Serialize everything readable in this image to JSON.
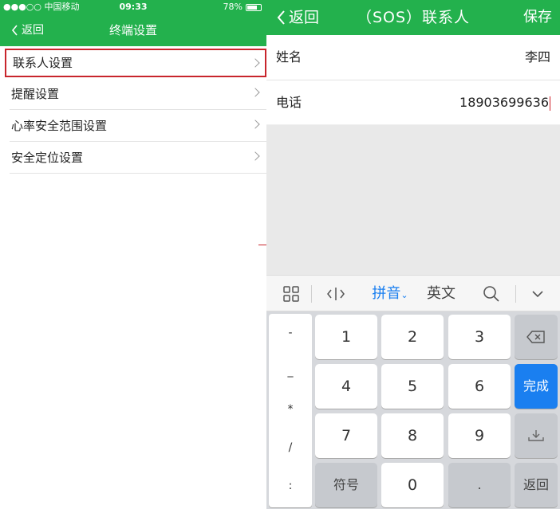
{
  "left": {
    "status": {
      "carrier": "●●●○○ 中国移动",
      "time": "09:33",
      "battery": "78%",
      "battery_level": 0.78
    },
    "nav": {
      "back": "返回",
      "title": "终端设置"
    },
    "menu": [
      {
        "label": "联系人设置"
      },
      {
        "label": "提醒设置"
      },
      {
        "label": "心率安全范围设置"
      },
      {
        "label": "安全定位设置"
      }
    ]
  },
  "right": {
    "header": {
      "back": "返回",
      "title": "（SOS）联系人",
      "save": "保存"
    },
    "form": {
      "name_label": "姓名",
      "name_value": "李四",
      "phone_label": "电话",
      "phone_value": "18903699636"
    },
    "toolbar": {
      "pinyin": "拼音",
      "english": "英文"
    },
    "symbols": [
      "-",
      "_",
      "*",
      "/",
      ":"
    ],
    "keys": {
      "k1": "1",
      "k2": "2",
      "k3": "3",
      "k4": "4",
      "k5": "5",
      "k6": "6",
      "k7": "7",
      "k8": "8",
      "k9": "9",
      "symbol": "符号",
      "k0": "0",
      "dot": ".",
      "done": "完成",
      "return": "返回"
    }
  }
}
